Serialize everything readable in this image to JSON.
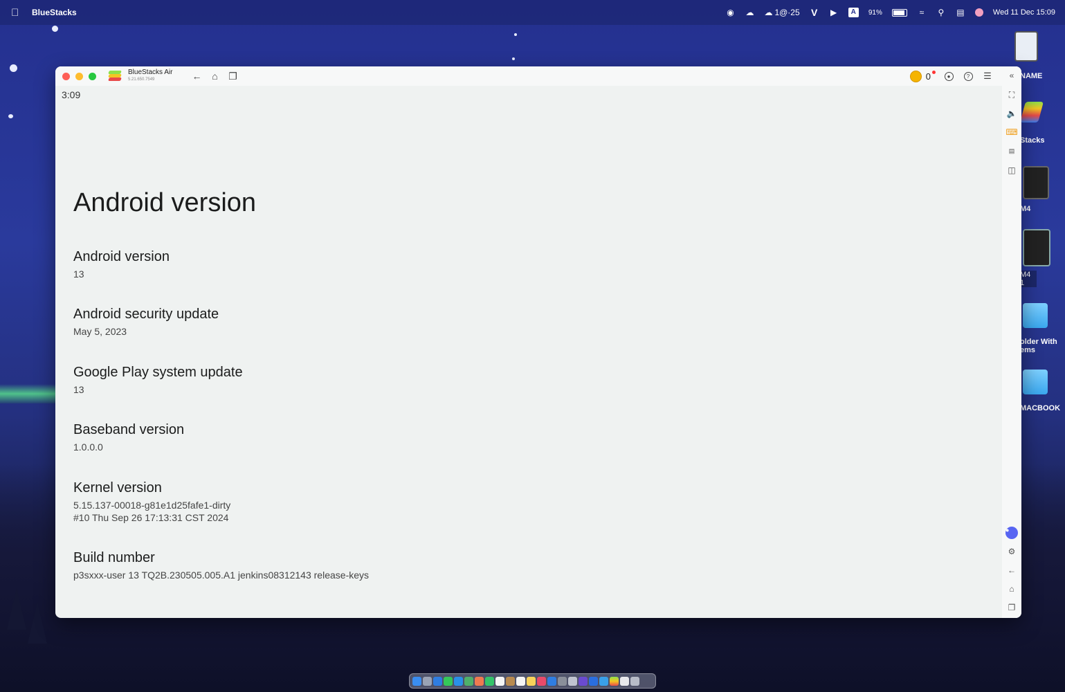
{
  "menubar": {
    "app_name": "BlueStacks",
    "right_items": {
      "weather": "1@·25",
      "v_label": "V",
      "input_label": "A",
      "battery": "91%",
      "datetime": "Wed 11 Dec  15:09"
    }
  },
  "desktop": {
    "icons": [
      {
        "label": "NAME"
      },
      {
        "label": "Stacks"
      },
      {
        "label": "M4"
      },
      {
        "label": "M4 1"
      },
      {
        "label": "older With\nems"
      },
      {
        "label": "MACBOOK"
      }
    ]
  },
  "window": {
    "title": "BlueStacks Air",
    "version": "5.21.650.7549",
    "coin_count": "0",
    "colors": {
      "accent": "#f5b400",
      "close": "#fe5f57",
      "minimize": "#febc2e",
      "zoom": "#28c840"
    }
  },
  "android": {
    "status_time": "3:09",
    "page_title": "Android version",
    "items": [
      {
        "label": "Android version",
        "value": "13"
      },
      {
        "label": "Android security update",
        "value": "May 5, 2023"
      },
      {
        "label": "Google Play system update",
        "value": "13"
      },
      {
        "label": "Baseband version",
        "value": "1.0.0.0"
      },
      {
        "label": "Kernel version",
        "value": "5.15.137-00018-g81e1d25fafe1-dirty\n#10 Thu Sep 26 17:13:31 CST 2024"
      },
      {
        "label": "Build number",
        "value": "p3sxxx-user 13 TQ2B.230505.005.A1 jenkins08312143 release-keys"
      }
    ]
  }
}
